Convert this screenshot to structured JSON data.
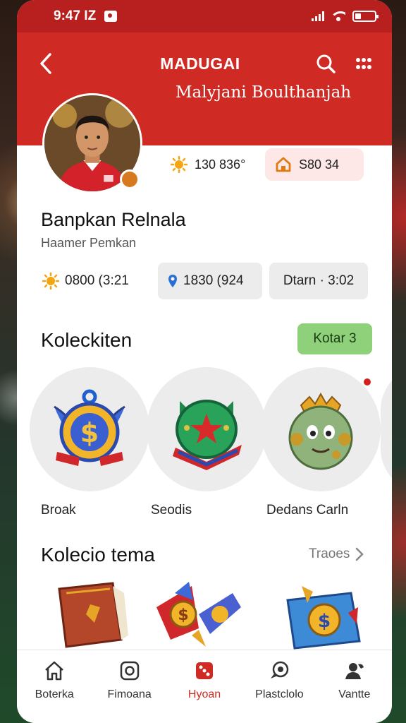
{
  "status_bar": {
    "time": "9:47 IZ"
  },
  "header": {
    "title": "MADUGAI",
    "profile_name": "Malyjani Boulthanjah"
  },
  "stats": {
    "coins": "130 836°",
    "gems": "S80 34"
  },
  "profile": {
    "username": "Banpkan Relnala",
    "subtitle": "Haamer Pemkan"
  },
  "chips": [
    {
      "icon": "sun-icon",
      "label": "0800 (3:21"
    },
    {
      "icon": "pin-icon",
      "label": "1830 (924"
    },
    {
      "label": "Dtarn · 3:02"
    }
  ],
  "collections": {
    "title": "Koleckiten",
    "button": "Kotar 3",
    "items": [
      {
        "label": "Broak",
        "icon": "dollar-badge-icon"
      },
      {
        "label": "Seodis",
        "icon": "star-helmet-icon"
      },
      {
        "label": "Dedans Carln",
        "icon": "crowned-egg-icon"
      }
    ]
  },
  "themes": {
    "title": "Kolecio tema",
    "see_all": "Traoes",
    "items": [
      {
        "icon": "book-icon"
      },
      {
        "icon": "coin-rocket-icon"
      },
      {
        "icon": "coin-card-icon"
      }
    ]
  },
  "tab_bar": {
    "tabs": [
      {
        "label": "Boterka",
        "icon": "home-icon"
      },
      {
        "label": "Fimoana",
        "icon": "camera-icon"
      },
      {
        "label": "Hyoan",
        "icon": "dice-icon",
        "active": true
      },
      {
        "label": "Plastclolo",
        "icon": "chat-icon"
      },
      {
        "label": "Vantte",
        "icon": "profile-icon"
      }
    ]
  },
  "colors": {
    "header_red": "#cf2a23",
    "status_red": "#b81f1f",
    "accent_green": "#8fd07a",
    "pill_pink": "#fde7e7"
  }
}
